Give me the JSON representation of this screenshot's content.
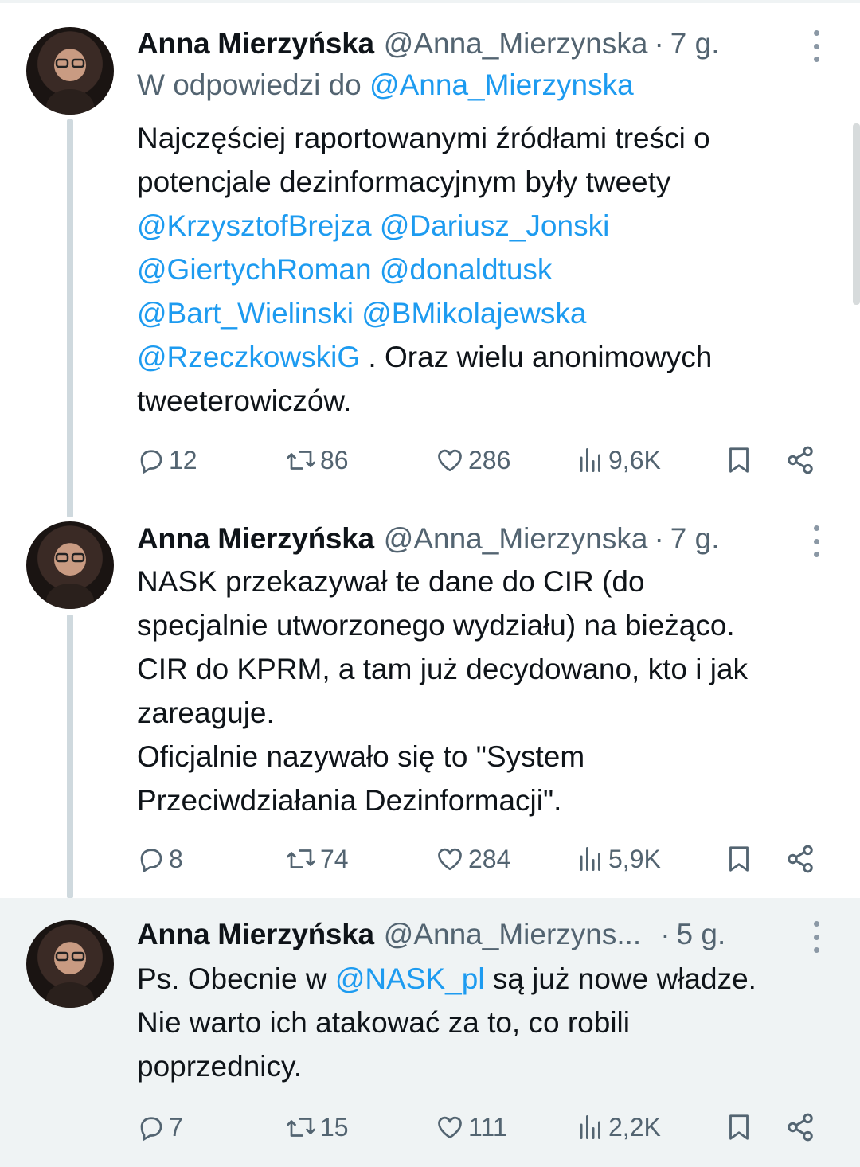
{
  "tweets": [
    {
      "name": "Anna Mierzyńska",
      "handle": "@Anna_Mierzynska",
      "time": "7 g.",
      "reply_to_prefix": "W odpowiedzi do",
      "reply_to_handle": "@Anna_Mierzynska",
      "text": {
        "l1": "Najczęściej raportowanymi źródłami treści o",
        "l2": "potencjale dezinformacyjnym były tweety",
        "m1": "@KrzysztofBrejza",
        "m2": "@Dariusz_Jonski",
        "m3": "@GiertychRoman",
        "m4": "@donaldtusk",
        "m5": "@Bart_Wielinski",
        "m6": "@BMikolajewska",
        "m7": "@RzeczkowskiG",
        "tail": " . Oraz wielu anonimowych",
        "l7": "tweeterowiczów."
      },
      "stats": {
        "replies": "12",
        "retweets": "86",
        "likes": "286",
        "views": "9,6K"
      }
    },
    {
      "name": "Anna Mierzyńska",
      "handle": "@Anna_Mierzynska",
      "time": "7 g.",
      "text": {
        "l1": "NASK przekazywał te dane do CIR (do",
        "l2": "specjalnie utworzonego wydziału) na bieżąco.",
        "l3": "CIR do KPRM, a tam już decydowano, kto i jak",
        "l4": "zareaguje.",
        "l5": "Oficjalnie nazywało się to \"System",
        "l6": "Przeciwdziałania Dezinformacji\"."
      },
      "stats": {
        "replies": "8",
        "retweets": "74",
        "likes": "284",
        "views": "5,9K"
      }
    },
    {
      "name": "Anna Mierzyńska",
      "handle": "@Anna_Mierzyns...",
      "time": "5 g.",
      "text": {
        "pre": "Ps. Obecnie w ",
        "mention": "@NASK_pl",
        "post": " są już nowe władze.",
        "l2": "Nie warto ich atakować za to, co robili",
        "l3": "poprzednicy."
      },
      "stats": {
        "replies": "7",
        "retweets": "15",
        "likes": "111",
        "views": "2,2K"
      }
    }
  ],
  "icons": [
    "reply-icon",
    "retweet-icon",
    "like-icon",
    "views-icon",
    "bookmark-icon",
    "share-icon",
    "more-icon"
  ],
  "colors": {
    "link": "#1d9bf0",
    "secondary": "#536471",
    "highlight_bg": "#eff3f4",
    "thread_line": "#cfd9de"
  }
}
